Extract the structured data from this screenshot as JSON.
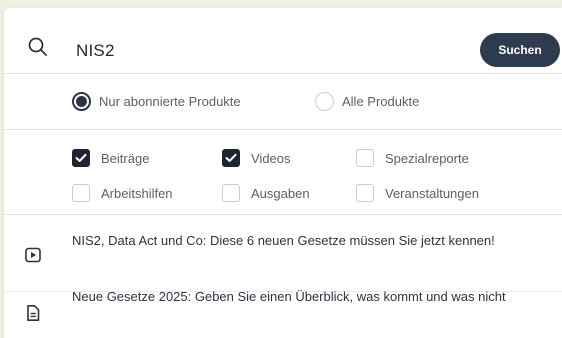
{
  "search": {
    "value": "NIS2",
    "button_label": "Suchen"
  },
  "scope": {
    "options": [
      {
        "label": "Nur abonnierte Produkte",
        "checked": true
      },
      {
        "label": "Alle Produkte",
        "checked": false
      }
    ]
  },
  "content_types": [
    {
      "label": "Beiträge",
      "checked": true
    },
    {
      "label": "Videos",
      "checked": true
    },
    {
      "label": "Spezialreporte",
      "checked": false
    },
    {
      "label": "Arbeitshilfen",
      "checked": false
    },
    {
      "label": "Ausgaben",
      "checked": false
    },
    {
      "label": "Veranstaltungen",
      "checked": false
    }
  ],
  "results": [
    {
      "icon": "video-icon",
      "title": "NIS2, Data Act und Co: Diese 6 neuen Gesetze müssen Sie jetzt kennen!"
    },
    {
      "icon": "document-icon",
      "title": "Neue Gesetze 2025: Geben Sie einen Überblick, was kommt und was nicht"
    }
  ]
}
